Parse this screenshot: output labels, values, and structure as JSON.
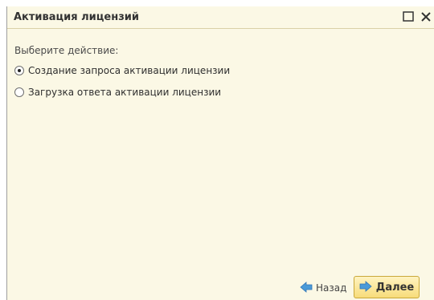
{
  "window": {
    "title": "Активация лицензий",
    "maximize_icon": "maximize-icon",
    "close_icon": "close-icon"
  },
  "form": {
    "prompt": "Выберите действие:",
    "options": [
      {
        "label": "Создание запроса активации лицензии",
        "selected": true
      },
      {
        "label": "Загрузка ответа активации лицензии",
        "selected": false
      }
    ]
  },
  "buttons": {
    "back_label": "Назад",
    "next_label": "Далее",
    "back_icon": "arrow-left-icon",
    "next_icon": "arrow-right-icon"
  },
  "colors": {
    "background": "#fbf8e5",
    "primary_button": "#f7dc7a",
    "arrow": "#4a9ad8"
  }
}
